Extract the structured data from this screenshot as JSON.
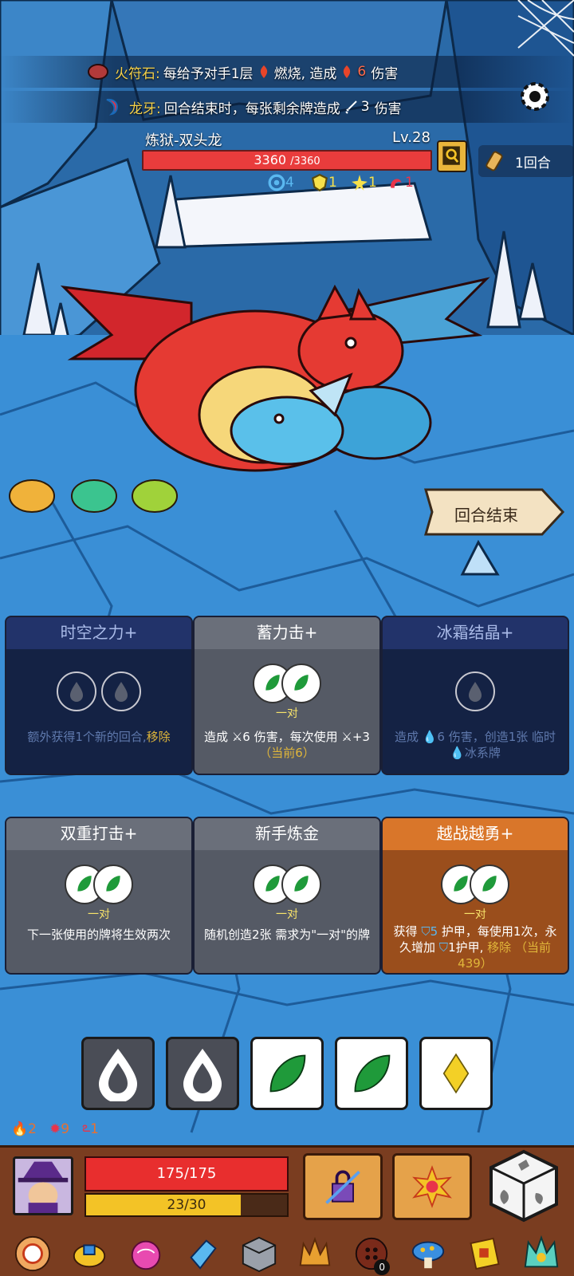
{
  "relics_top": [
    {
      "name": "火符石:",
      "text_a": "每给予对手1层",
      "burn_label": "燃烧",
      "text_b": ", 造成",
      "dmg": "6",
      "text_c": "伤害"
    },
    {
      "name": "龙牙:",
      "text_a": "回合结束时，每张剩余牌造成",
      "dmg": "3",
      "text_c": "伤害"
    }
  ],
  "boss": {
    "name": "炼狱-双头龙",
    "level": "Lv.28",
    "hp_current": "3360",
    "hp_max": "/3360",
    "status": {
      "spiral": "4",
      "armor": "1",
      "star": "1",
      "curse": "1"
    }
  },
  "turn": {
    "label": "1回合"
  },
  "end_turn_label": "回合结束",
  "cards": [
    {
      "title": "时空之力+",
      "style": "dark",
      "slots": [
        "drop",
        "drop"
      ],
      "pair_label": "",
      "desc_a": "额外获得1个新的回合,",
      "desc_hl": "移除",
      "desc_b": ""
    },
    {
      "title": "蓄力击+",
      "style": "grey",
      "slots": [
        "leaf",
        "leaf"
      ],
      "pair_label": "一对",
      "desc_a": "造成",
      "desc_dmg": "6",
      "desc_b": "伤害，每次使用",
      "desc_c": "+3",
      "desc_hl": "（当前6）"
    },
    {
      "title": "冰霜结晶+",
      "style": "dark",
      "slots": [
        "drop"
      ],
      "pair_label": "",
      "desc_a": "造成",
      "desc_dmg": "6",
      "desc_b": "伤害，创造1张 临时",
      "desc_c": "冰系牌"
    },
    {
      "title": "双重打击+",
      "style": "grey",
      "slots": [
        "leaf",
        "leaf"
      ],
      "pair_label": "一对",
      "desc_a": "下一张使用的牌将生效两次"
    },
    {
      "title": "新手炼金",
      "style": "grey",
      "slots": [
        "leaf",
        "leaf"
      ],
      "pair_label": "一对",
      "desc_a": "随机创造2张 需求为\"一对\"的牌"
    },
    {
      "title": "越战越勇+",
      "style": "orange",
      "slots": [
        "leaf",
        "leaf"
      ],
      "pair_label": "一对",
      "desc_a": "获得",
      "desc_armor": "5",
      "desc_b": "护甲，每使用1次，永久增加",
      "desc_armor2": "1",
      "desc_c": "护甲,",
      "desc_hl": "移除",
      "desc_hl2": "（当前439）"
    }
  ],
  "dice": [
    "drop",
    "drop",
    "leaf",
    "leaf",
    "diamond"
  ],
  "player": {
    "status": {
      "burn": "2",
      "gear": "9",
      "curse": "1"
    },
    "hp": "175/175",
    "energy": "23/30",
    "energy_fraction": 0.77
  },
  "relic_bar": {
    "badge_count": "0"
  },
  "colors": {
    "boss_hp": "#e93c3c",
    "player_hp": "#e82e2e",
    "energy": "#f3c326",
    "gold_text": "#f6d24a"
  }
}
